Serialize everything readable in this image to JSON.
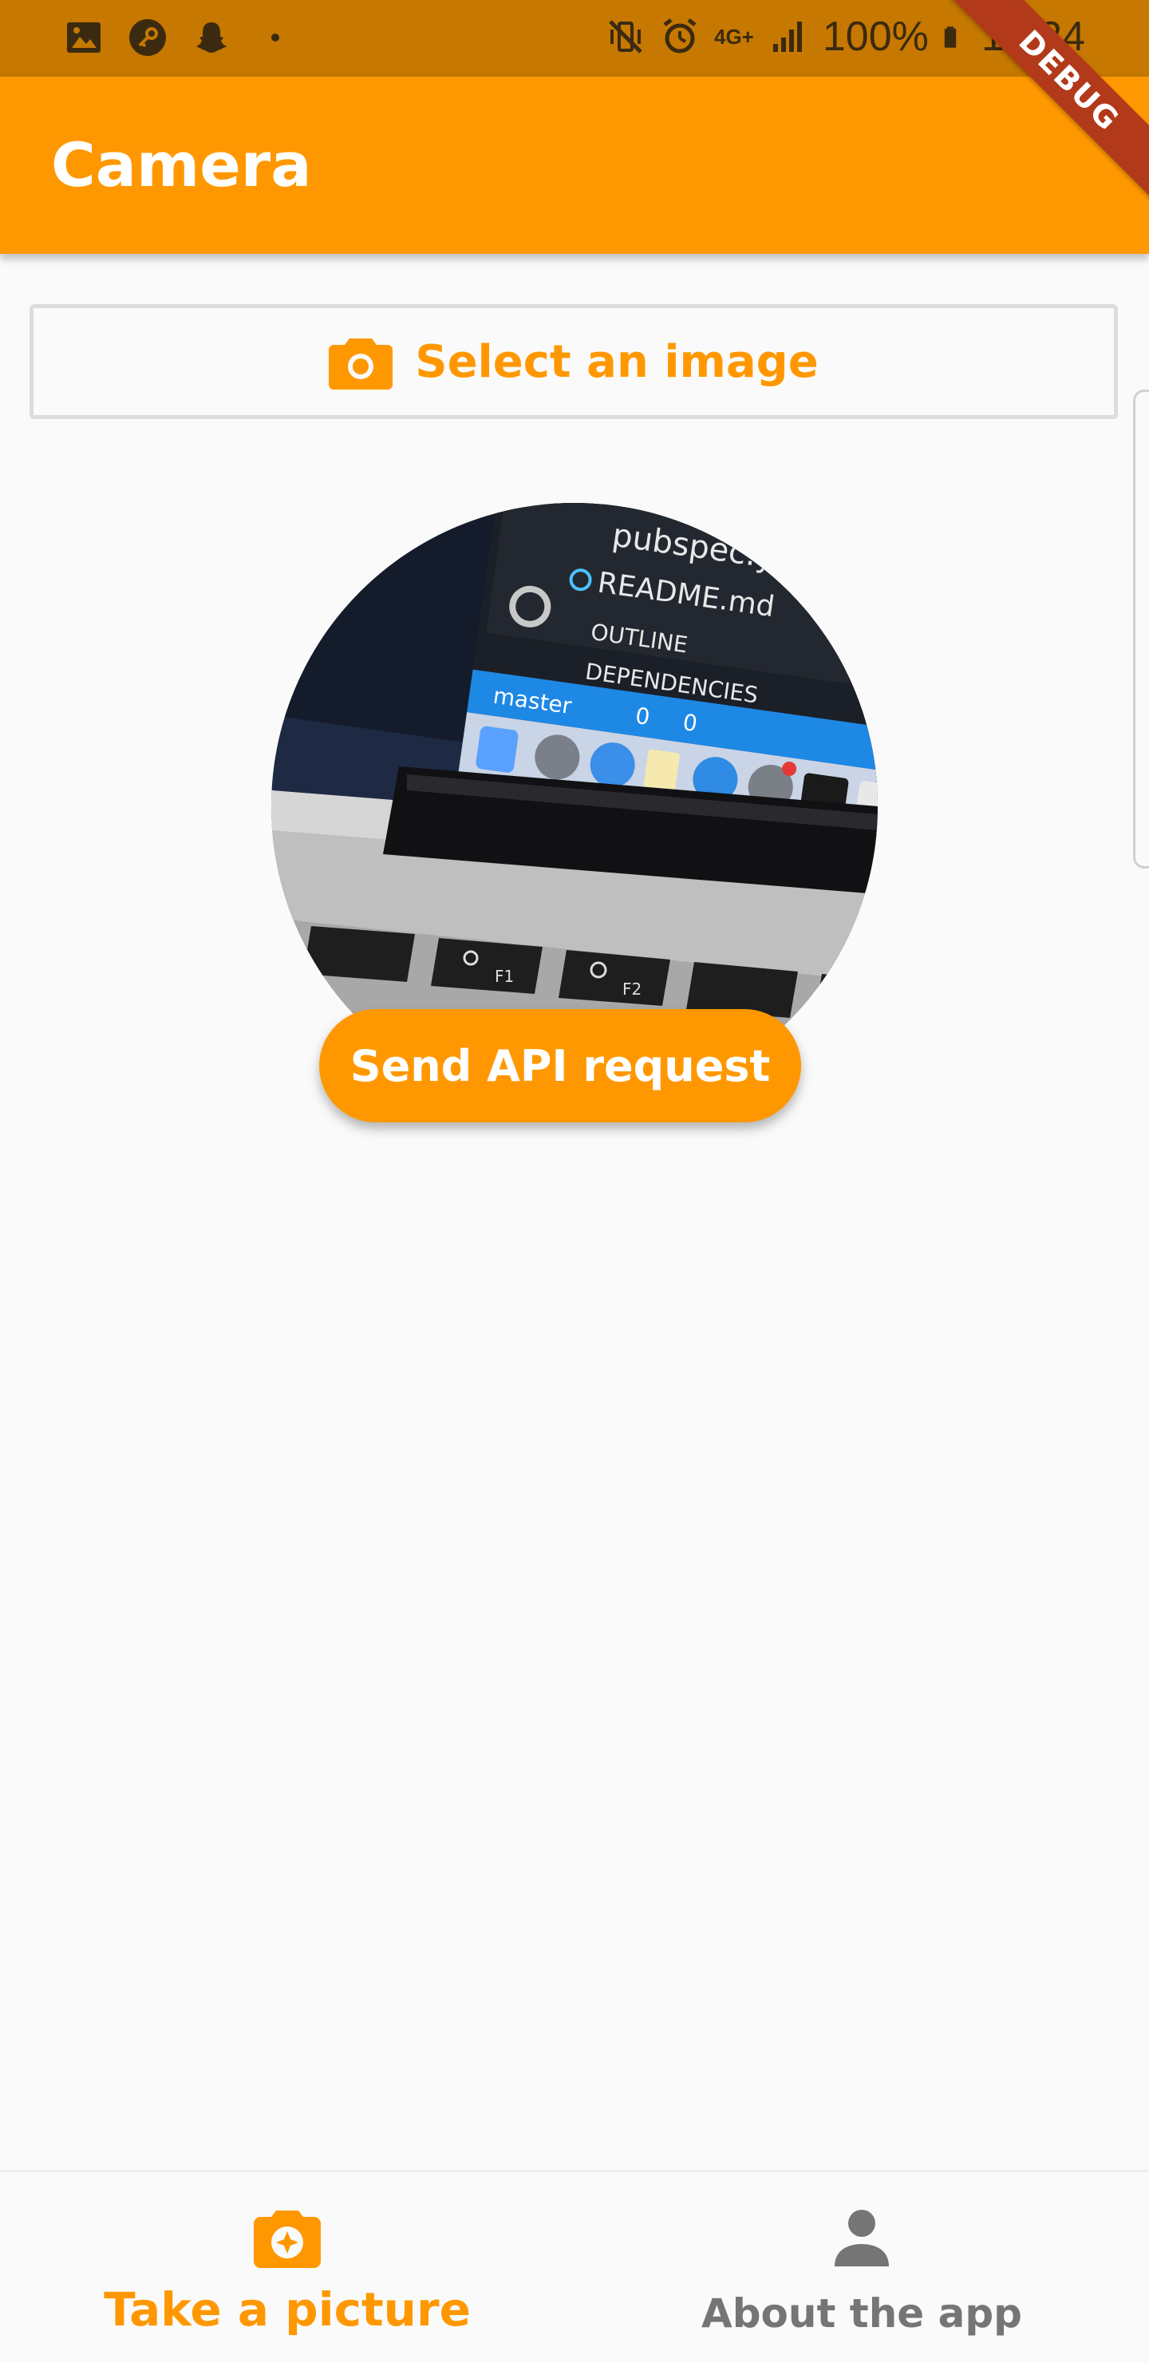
{
  "status_bar": {
    "left_icons": [
      "image-icon",
      "key-icon",
      "snapchat-icon",
      "dot-icon"
    ],
    "right_icons": [
      "vibrate-mute-icon",
      "alarm-icon",
      "network-4g-icon",
      "signal-icon",
      "battery-icon"
    ],
    "network": "4G+",
    "battery": "100%",
    "time": "12:24"
  },
  "debug_banner": "DEBUG",
  "app_bar": {
    "title": "Camera"
  },
  "select_button": {
    "label": "Select an image",
    "icon": "camera-icon"
  },
  "send_button": {
    "label": "Send API request"
  },
  "bottom_nav": {
    "items": [
      {
        "label": "Take a picture",
        "icon": "camera-enhance-icon",
        "active": true
      },
      {
        "label": "About the app",
        "icon": "person-icon",
        "active": false
      }
    ]
  },
  "colors": {
    "primary": "#ff9800",
    "status_bar": "#c67800",
    "debug": "#b23a1a",
    "inactive": "#757575",
    "background": "#fafafa"
  },
  "photo": {
    "screen_text": [
      "pubspec.y",
      "README.md",
      "OUTLINE",
      "DEPENDENCIES",
      "master",
      "0",
      "0"
    ],
    "keys": [
      "F1",
      "F2"
    ]
  }
}
